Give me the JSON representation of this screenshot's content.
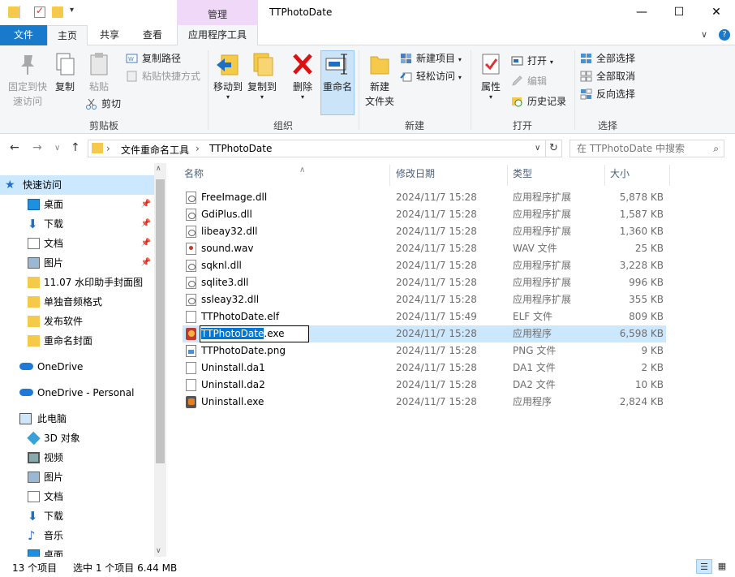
{
  "title_bar": {
    "context_tab_label": "管理",
    "window_title": "TTPhotoDate",
    "minimize": "—",
    "maximize": "☐",
    "close": "✕"
  },
  "ribbon_tabs": {
    "file": "文件",
    "home": "主页",
    "share": "共享",
    "view": "查看",
    "app_tools": "应用程序工具",
    "collapse": "∨",
    "help": "?"
  },
  "ribbon": {
    "clipboard": {
      "label": "剪贴板",
      "pin_quick_access_l1": "固定到快",
      "pin_quick_access_l2": "速访问",
      "copy": "复制",
      "paste": "粘贴",
      "copy_path": "复制路径",
      "paste_shortcut": "粘贴快捷方式",
      "cut": "剪切"
    },
    "organize": {
      "label": "组织",
      "move_to": "移动到",
      "copy_to": "复制到",
      "delete": "删除",
      "rename": "重命名"
    },
    "new": {
      "label": "新建",
      "new_folder_l1": "新建",
      "new_folder_l2": "文件夹",
      "new_item": "新建项目",
      "easy_access": "轻松访问"
    },
    "open": {
      "label": "打开",
      "properties": "属性",
      "open": "打开",
      "edit": "编辑",
      "history": "历史记录"
    },
    "select": {
      "label": "选择",
      "select_all": "全部选择",
      "select_none": "全部取消",
      "invert": "反向选择"
    }
  },
  "address_bar": {
    "crumbs": [
      "文件重命名工具",
      "TTPhotoDate"
    ],
    "search_placeholder": "在 TTPhotoDate 中搜索"
  },
  "nav_pane": {
    "quick_access": "快速访问",
    "items": [
      {
        "label": "桌面",
        "icon": "desktop-icon",
        "pinned": true
      },
      {
        "label": "下载",
        "icon": "download-icon",
        "pinned": true
      },
      {
        "label": "文档",
        "icon": "document-icon",
        "pinned": true
      },
      {
        "label": "图片",
        "icon": "picture-icon",
        "pinned": true
      },
      {
        "label": "11.07 水印助手封面图",
        "icon": "folder-icon",
        "pinned": false
      },
      {
        "label": "单独音频格式",
        "icon": "folder-icon",
        "pinned": false
      },
      {
        "label": "发布软件",
        "icon": "folder-icon",
        "pinned": false
      },
      {
        "label": "重命名封面",
        "icon": "folder-icon",
        "pinned": false
      }
    ],
    "onedrive": "OneDrive",
    "onedrive_personal": "OneDrive - Personal",
    "this_pc": "此电脑",
    "pc_items": [
      {
        "label": "3D 对象",
        "icon": "3d-objects-icon"
      },
      {
        "label": "视频",
        "icon": "video-icon"
      },
      {
        "label": "图片",
        "icon": "picture-icon"
      },
      {
        "label": "文档",
        "icon": "document-icon"
      },
      {
        "label": "下载",
        "icon": "download-icon"
      },
      {
        "label": "音乐",
        "icon": "music-icon"
      },
      {
        "label": "桌面",
        "icon": "desktop-icon"
      }
    ]
  },
  "file_list": {
    "columns": {
      "name": "名称",
      "date": "修改日期",
      "type": "类型",
      "size": "大小"
    },
    "rows": [
      {
        "name": "FreeImage.dll",
        "date": "2024/11/7 15:28",
        "type": "应用程序扩展",
        "size": "5,878 KB",
        "icon": "dll"
      },
      {
        "name": "GdiPlus.dll",
        "date": "2024/11/7 15:28",
        "type": "应用程序扩展",
        "size": "1,587 KB",
        "icon": "dll"
      },
      {
        "name": "libeay32.dll",
        "date": "2024/11/7 15:28",
        "type": "应用程序扩展",
        "size": "1,360 KB",
        "icon": "dll"
      },
      {
        "name": "sound.wav",
        "date": "2024/11/7 15:28",
        "type": "WAV 文件",
        "size": "25 KB",
        "icon": "wav"
      },
      {
        "name": "sqknl.dll",
        "date": "2024/11/7 15:28",
        "type": "应用程序扩展",
        "size": "3,228 KB",
        "icon": "dll"
      },
      {
        "name": "sqlite3.dll",
        "date": "2024/11/7 15:28",
        "type": "应用程序扩展",
        "size": "996 KB",
        "icon": "dll"
      },
      {
        "name": "ssleay32.dll",
        "date": "2024/11/7 15:28",
        "type": "应用程序扩展",
        "size": "355 KB",
        "icon": "dll"
      },
      {
        "name": "TTPhotoDate.elf",
        "date": "2024/11/7 15:49",
        "type": "ELF 文件",
        "size": "809 KB",
        "icon": "file"
      },
      {
        "name": "TTPhotoDate.exe",
        "date": "2024/11/7 15:28",
        "type": "应用程序",
        "size": "6,598 KB",
        "icon": "exe"
      },
      {
        "name": "TTPhotoDate.png",
        "date": "2024/11/7 15:28",
        "type": "PNG 文件",
        "size": "9 KB",
        "icon": "png"
      },
      {
        "name": "Uninstall.da1",
        "date": "2024/11/7 15:28",
        "type": "DA1 文件",
        "size": "2 KB",
        "icon": "file"
      },
      {
        "name": "Uninstall.da2",
        "date": "2024/11/7 15:28",
        "type": "DA2 文件",
        "size": "10 KB",
        "icon": "file"
      },
      {
        "name": "Uninstall.exe",
        "date": "2024/11/7 15:28",
        "type": "应用程序",
        "size": "2,824 KB",
        "icon": "exe2"
      }
    ],
    "rename_edit": {
      "selected_part": "TTPhotoDate",
      "rest": ".exe"
    }
  },
  "status_bar": {
    "count": "13 个项目",
    "selection": "选中 1 个项目  6.44 MB"
  }
}
